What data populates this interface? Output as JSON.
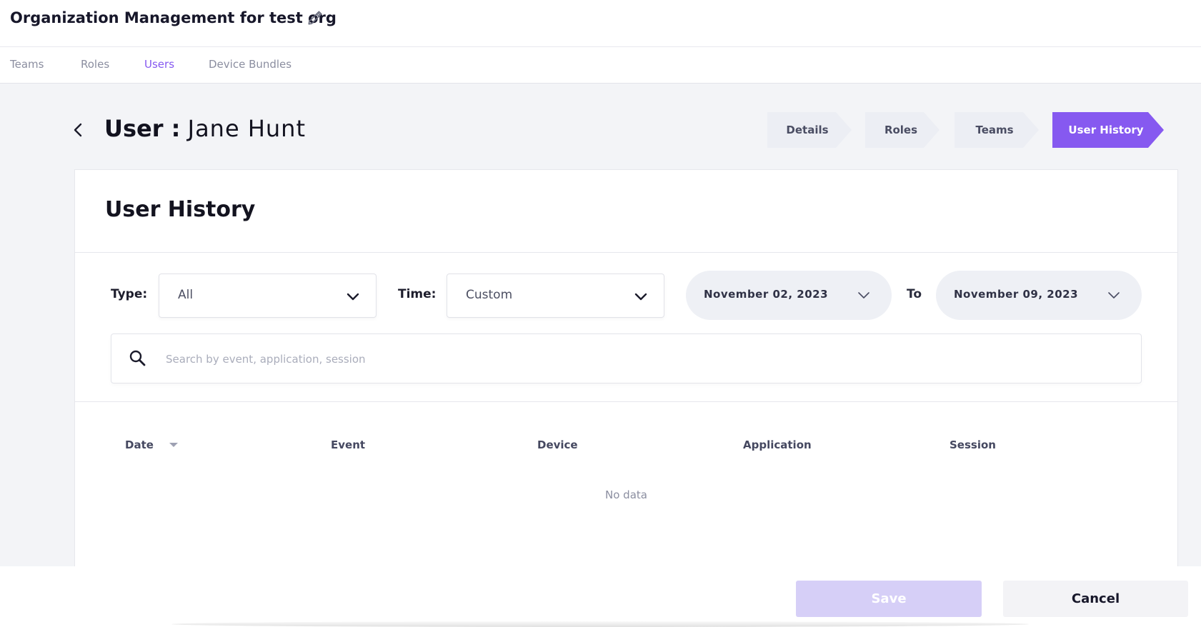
{
  "header": {
    "org_title": "Organization Management for test org",
    "edit_icon": "pencil-icon"
  },
  "nav": {
    "tabs": [
      {
        "label": "Teams",
        "active": false
      },
      {
        "label": "Roles",
        "active": false
      },
      {
        "label": "Users",
        "active": true
      },
      {
        "label": "Device Bundles",
        "active": false
      }
    ]
  },
  "user": {
    "label": "User :",
    "name": "Jane Hunt"
  },
  "steps": [
    {
      "label": "Details",
      "active": false
    },
    {
      "label": "Roles",
      "active": false
    },
    {
      "label": "Teams",
      "active": false
    },
    {
      "label": "User History",
      "active": true
    }
  ],
  "history": {
    "title": "User History",
    "type_label": "Type:",
    "type_value": "All",
    "time_label": "Time:",
    "time_value": "Custom",
    "date_from": "November 02, 2023",
    "to_label": "To",
    "date_to": "November 09, 2023",
    "search_placeholder": "Search by event, application, session",
    "columns": [
      "Date",
      "Event",
      "Device",
      "Application",
      "Session"
    ],
    "empty_text": "No data"
  },
  "footer": {
    "save_label": "Save",
    "cancel_label": "Cancel"
  },
  "colors": {
    "accent": "#8659f0",
    "step_inactive": "#eceef4",
    "save_disabled": "#d6cff7"
  }
}
